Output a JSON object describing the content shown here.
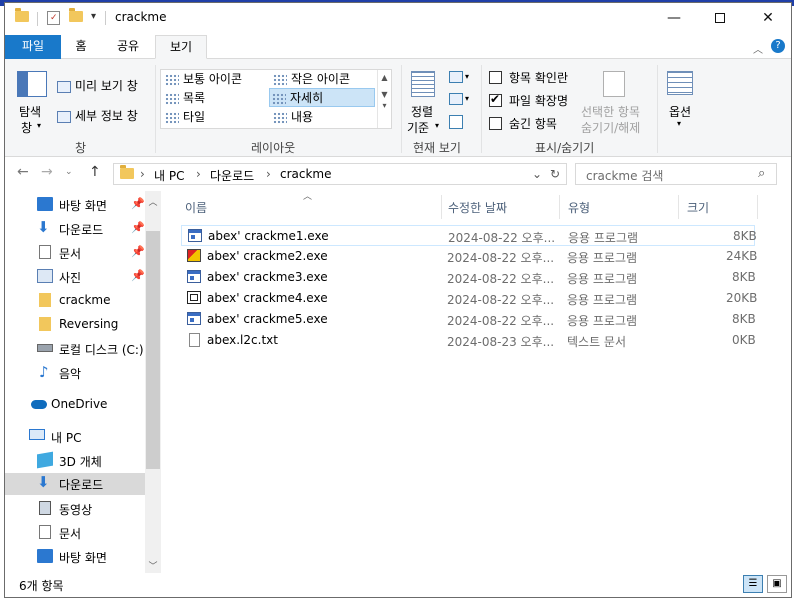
{
  "window": {
    "title": "crackme"
  },
  "ribbon_tabs": [
    "파일",
    "홈",
    "공유",
    "보기"
  ],
  "ribbon": {
    "pane_group": {
      "nav_pane": "탐색",
      "nav_pane_sub": "창",
      "preview": "미리 보기 창",
      "details": "세부 정보 창",
      "label": "창"
    },
    "layout_group": {
      "items": [
        "보통 아이콘",
        "작은 아이콘",
        "목록",
        "자세히",
        "타일",
        "내용"
      ],
      "selected": "자세히",
      "label": "레이아웃"
    },
    "current_view_group": {
      "sort_by_1": "정렬",
      "sort_by_2": "기준",
      "label": "현재 보기"
    },
    "show_hide_group": {
      "item_checkboxes": "항목 확인란",
      "file_extensions": "파일 확장명",
      "hidden_items": "숨긴 항목",
      "hide_selected_1": "선택한 항목",
      "hide_selected_2": "숨기기/해제",
      "label": "표시/숨기기"
    },
    "options": "옵션"
  },
  "address": {
    "segments": [
      "내 PC",
      "다운로드",
      "crackme"
    ],
    "search_placeholder": "crackme 검색"
  },
  "sidebar": {
    "items": [
      {
        "label": "바탕 화면"
      },
      {
        "label": "다운로드"
      },
      {
        "label": "문서"
      },
      {
        "label": "사진"
      },
      {
        "label": "crackme"
      },
      {
        "label": "Reversing"
      },
      {
        "label": "로컬 디스크 (C:)"
      },
      {
        "label": "음악"
      },
      {
        "label": "OneDrive"
      },
      {
        "label": "내 PC"
      },
      {
        "label": "3D 개체"
      },
      {
        "label": "다운로드"
      },
      {
        "label": "동영상"
      },
      {
        "label": "문서"
      },
      {
        "label": "바탕 화면"
      }
    ]
  },
  "columns": [
    "이름",
    "수정한 날짜",
    "유형",
    "크기"
  ],
  "files": [
    {
      "name": "abex' crackme1.exe",
      "date": "2024-08-22 오후...",
      "type": "응용 프로그램",
      "size": "8KB"
    },
    {
      "name": "abex' crackme2.exe",
      "date": "2024-08-22 오후...",
      "type": "응용 프로그램",
      "size": "24KB"
    },
    {
      "name": "abex' crackme3.exe",
      "date": "2024-08-22 오후...",
      "type": "응용 프로그램",
      "size": "8KB"
    },
    {
      "name": "abex' crackme4.exe",
      "date": "2024-08-22 오후...",
      "type": "응용 프로그램",
      "size": "20KB"
    },
    {
      "name": "abex' crackme5.exe",
      "date": "2024-08-22 오후...",
      "type": "응용 프로그램",
      "size": "8KB"
    },
    {
      "name": "abex.l2c.txt",
      "date": "2024-08-23 오후...",
      "type": "텍스트 문서",
      "size": "0KB"
    }
  ],
  "status": {
    "count": "6개 항목"
  }
}
